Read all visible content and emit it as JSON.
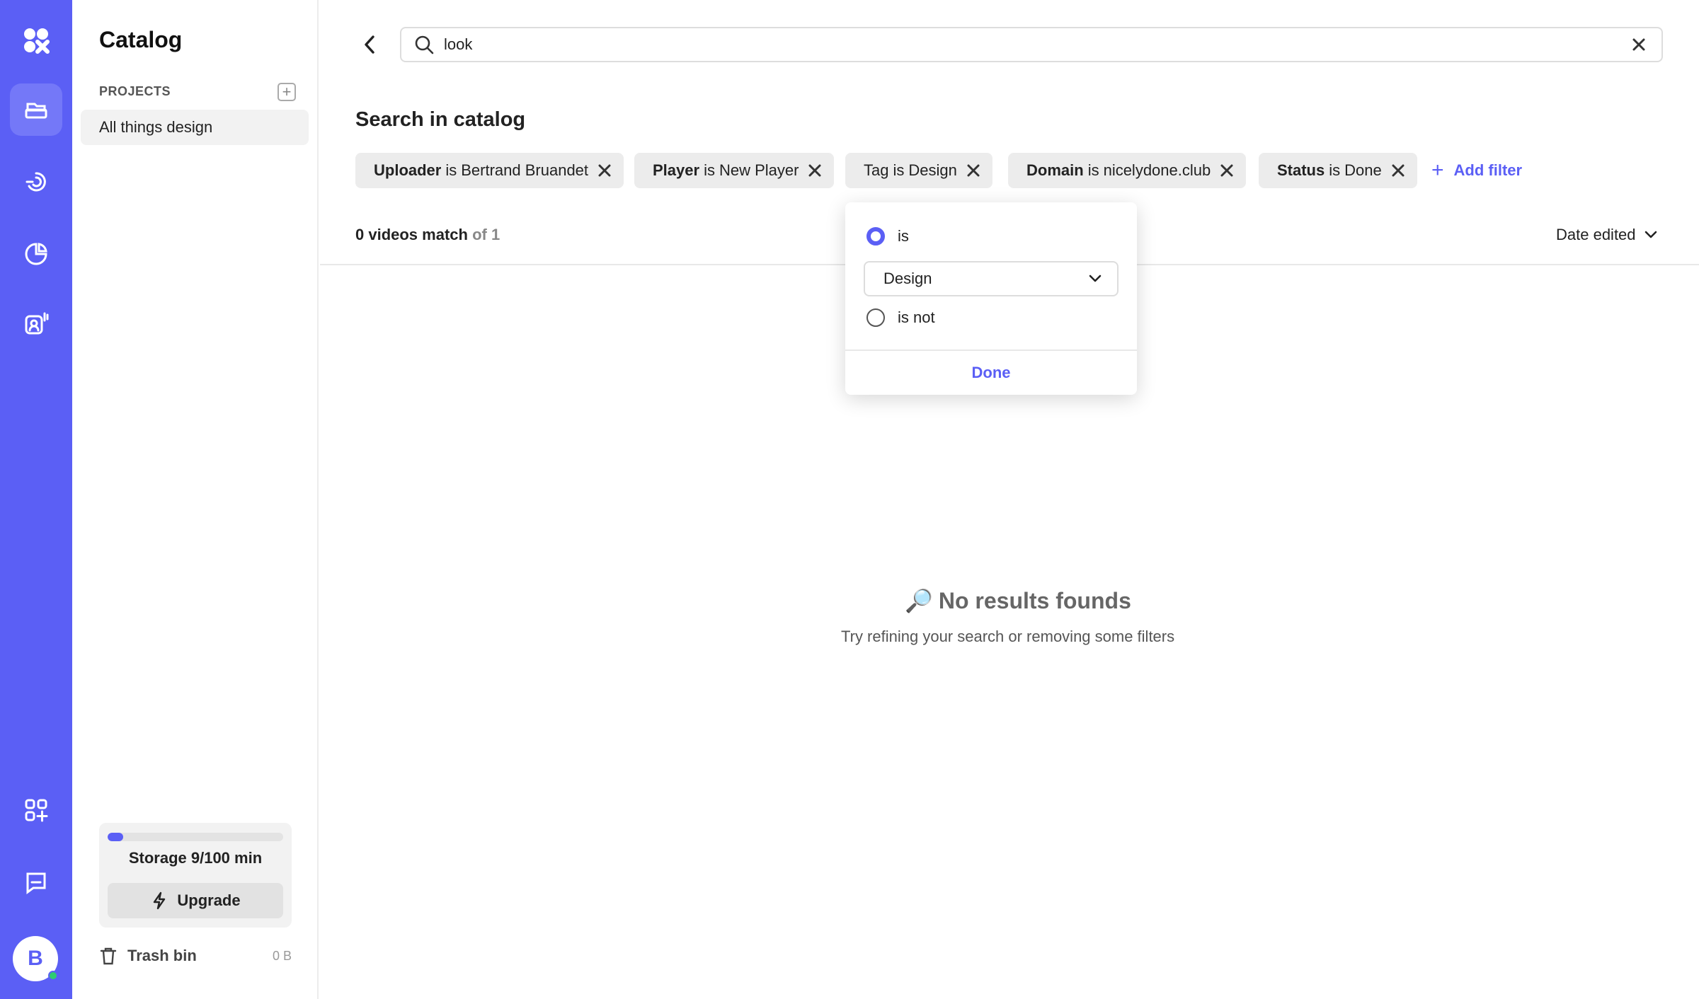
{
  "rail": {
    "icons": [
      "logo-icon",
      "catalog-icon",
      "broadcast-icon",
      "analytics-icon",
      "audience-icon",
      "integrations-icon",
      "messages-icon"
    ],
    "avatar_letter": "B"
  },
  "sidebar": {
    "title": "Catalog",
    "section_label": "PROJECTS",
    "projects": [
      "All things design"
    ],
    "storage": {
      "used": 9,
      "total": 100,
      "label": "Storage 9/100 min"
    },
    "upgrade_label": "Upgrade",
    "trash_label": "Trash bin",
    "trash_size": "0 B"
  },
  "search": {
    "value": "look",
    "placeholder": ""
  },
  "main": {
    "heading": "Search in catalog",
    "filters": [
      {
        "field": "Uploader",
        "op": "is",
        "value": "Bertrand Bruandet"
      },
      {
        "field": "Player",
        "op": "is",
        "value": "New Player"
      },
      {
        "field": "Tag",
        "op": "is",
        "value": "Design",
        "field_plain": true
      },
      {
        "field": "Domain",
        "op": "is",
        "value": "nicelydone.club"
      },
      {
        "field": "Status",
        "op": "is",
        "value": "Done"
      }
    ],
    "add_filter_label": "Add filter",
    "match_count": "0 videos match",
    "match_total": "of 1",
    "sort_label": "Date edited",
    "empty_title": "No results founds",
    "empty_emoji": "🔎",
    "empty_subtitle": "Try refining your search or removing some filters"
  },
  "popover": {
    "option_is": "is",
    "option_is_not": "is not",
    "selected_option": "is",
    "select_value": "Design",
    "done_label": "Done"
  },
  "colors": {
    "accent": "#5b5ff5",
    "rail_active": "#7478f8",
    "chip_bg": "#ececec"
  }
}
